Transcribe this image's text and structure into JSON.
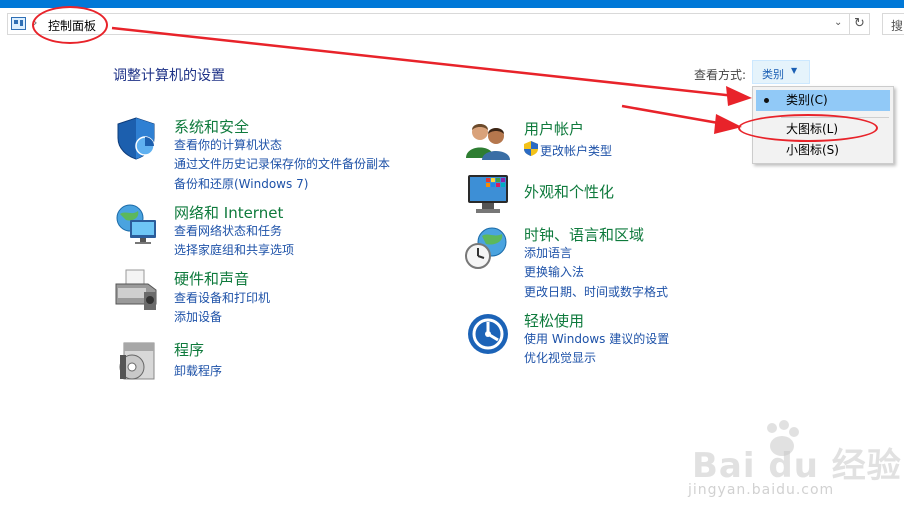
{
  "address": {
    "breadcrumb": "控制面板",
    "search_label": "搜"
  },
  "header": {
    "title": "调整计算机的设置",
    "view_by_label": "查看方式:",
    "view_by_value": "类别"
  },
  "view_menu": {
    "items": [
      {
        "label": "类别(C)",
        "selected": true
      },
      {
        "label": "大图标(L)",
        "selected": false
      },
      {
        "label": "小图标(S)",
        "selected": false
      }
    ]
  },
  "categories": [
    {
      "title": "系统和安全",
      "icon": "shield-icon",
      "links": [
        "查看你的计算机状态",
        "通过文件历史记录保存你的文件备份副本",
        "备份和还原(Windows 7)"
      ]
    },
    {
      "title": "网络和 Internet",
      "icon": "network-globe-icon",
      "links": [
        "查看网络状态和任务",
        "选择家庭组和共享选项"
      ]
    },
    {
      "title": "硬件和声音",
      "icon": "printer-icon",
      "links": [
        "查看设备和打印机",
        "添加设备"
      ]
    },
    {
      "title": "程序",
      "icon": "programs-disc-icon",
      "links": [
        "卸载程序"
      ]
    },
    {
      "title": "用户帐户",
      "icon": "users-icon",
      "links": [
        "更改帐户类型"
      ]
    },
    {
      "title": "外观和个性化",
      "icon": "monitor-colors-icon",
      "links": []
    },
    {
      "title": "时钟、语言和区域",
      "icon": "clock-globe-icon",
      "links": [
        "添加语言",
        "更换输入法",
        "更改日期、时间或数字格式"
      ]
    },
    {
      "title": "轻松使用",
      "icon": "ease-of-access-icon",
      "links": [
        "使用 Windows 建议的设置",
        "优化视觉显示"
      ]
    }
  ],
  "watermark": {
    "logo_text": "Bai du 经验",
    "url": "jingyan.baidu.com"
  },
  "colors": {
    "accent": "#0078d7",
    "category_title": "#0e7a3c",
    "link": "#1e52a8",
    "annotation_red": "#e8232a",
    "menu_selected": "#91c9f7"
  }
}
